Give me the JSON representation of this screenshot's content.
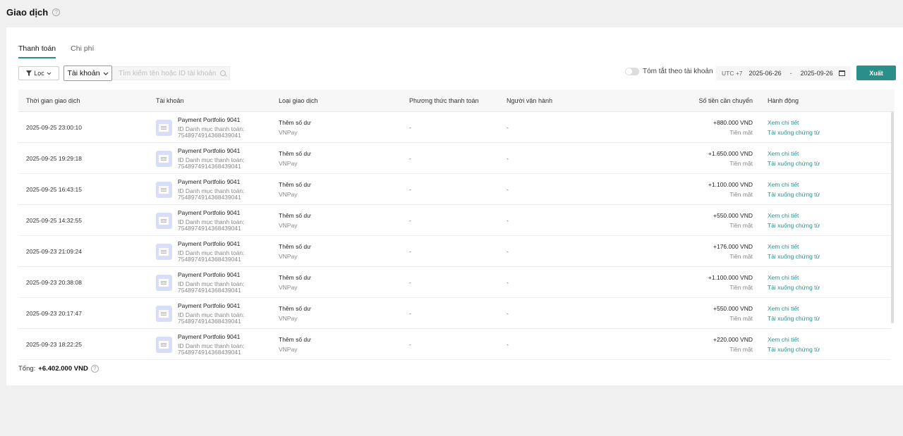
{
  "page": {
    "title": "Giao dịch"
  },
  "tabs": [
    {
      "label": "Thanh toán",
      "active": true
    },
    {
      "label": "Chi phí",
      "active": false
    }
  ],
  "toolbar": {
    "filter_label": "Lọc",
    "account_label": "Tài khoản",
    "search_placeholder": "Tìm kiếm tên hoặc ID tài khoản",
    "summary_toggle_label": "Tóm tắt theo tài khoản",
    "timezone": "UTC +7",
    "date_start": "2025-06-26",
    "date_separator": "-",
    "date_end": "2025-09-26",
    "export_label": "Xuất"
  },
  "table": {
    "headers": {
      "time": "Thời gian giao dịch",
      "account": "Tài khoản",
      "type": "Loại giao dịch",
      "payment_method": "Phương thức thanh toán",
      "operator": "Người vận hành",
      "amount": "Số tiền cần chuyển",
      "actions": "Hành động"
    },
    "rows": [
      {
        "time": "2025-09-25 23:00:10",
        "account_name": "Payment Portfolio 9041",
        "account_sub1": "ID Danh mục thanh toán:",
        "account_sub2": "7548974914368439041",
        "type": "Thêm số dư",
        "method": "VNPay",
        "payment": "-",
        "operator": "-",
        "amount": "+880.000 VND",
        "cash": "Tiền mặt",
        "action_view": "Xem chi tiết",
        "action_download": "Tải xuống chứng từ"
      },
      {
        "time": "2025-09-25 19:29:18",
        "account_name": "Payment Portfolio 9041",
        "account_sub1": "ID Danh mục thanh toán:",
        "account_sub2": "7548974914368439041",
        "type": "Thêm số dư",
        "method": "VNPay",
        "payment": "-",
        "operator": "-",
        "amount": "+1.650.000 VND",
        "cash": "Tiền mặt",
        "action_view": "Xem chi tiết",
        "action_download": "Tải xuống chứng từ"
      },
      {
        "time": "2025-09-25 16:43:15",
        "account_name": "Payment Portfolio 9041",
        "account_sub1": "ID Danh mục thanh toán:",
        "account_sub2": "7548974914368439041",
        "type": "Thêm số dư",
        "method": "VNPay",
        "payment": "-",
        "operator": "-",
        "amount": "+1.100.000 VND",
        "cash": "Tiền mặt",
        "action_view": "Xem chi tiết",
        "action_download": "Tải xuống chứng từ"
      },
      {
        "time": "2025-09-25 14:32:55",
        "account_name": "Payment Portfolio 9041",
        "account_sub1": "ID Danh mục thanh toán:",
        "account_sub2": "7548974914368439041",
        "type": "Thêm số dư",
        "method": "VNPay",
        "payment": "-",
        "operator": "-",
        "amount": "+550.000 VND",
        "cash": "Tiền mặt",
        "action_view": "Xem chi tiết",
        "action_download": "Tải xuống chứng từ"
      },
      {
        "time": "2025-09-23 21:09:24",
        "account_name": "Payment Portfolio 9041",
        "account_sub1": "ID Danh mục thanh toán:",
        "account_sub2": "7548974914368439041",
        "type": "Thêm số dư",
        "method": "VNPay",
        "payment": "-",
        "operator": "-",
        "amount": "+176.000 VND",
        "cash": "Tiền mặt",
        "action_view": "Xem chi tiết",
        "action_download": "Tải xuống chứng từ"
      },
      {
        "time": "2025-09-23 20:38:08",
        "account_name": "Payment Portfolio 9041",
        "account_sub1": "ID Danh mục thanh toán:",
        "account_sub2": "7548974914368439041",
        "type": "Thêm số dư",
        "method": "VNPay",
        "payment": "-",
        "operator": "-",
        "amount": "+1.100.000 VND",
        "cash": "Tiền mặt",
        "action_view": "Xem chi tiết",
        "action_download": "Tải xuống chứng từ"
      },
      {
        "time": "2025-09-23 20:17:47",
        "account_name": "Payment Portfolio 9041",
        "account_sub1": "ID Danh mục thanh toán:",
        "account_sub2": "7548974914368439041",
        "type": "Thêm số dư",
        "method": "VNPay",
        "payment": "-",
        "operator": "-",
        "amount": "+550.000 VND",
        "cash": "Tiền mặt",
        "action_view": "Xem chi tiết",
        "action_download": "Tải xuống chứng từ"
      },
      {
        "time": "2025-09-23 18:22:25",
        "account_name": "Payment Portfolio 9041",
        "account_sub1": "ID Danh mục thanh toán:",
        "account_sub2": "7548974914368439041",
        "type": "Thêm số dư",
        "method": "VNPay",
        "payment": "-",
        "operator": "-",
        "amount": "+220.000 VND",
        "cash": "Tiền mặt",
        "action_view": "Xem chi tiết",
        "action_download": "Tải xuống chứng từ"
      }
    ]
  },
  "total": {
    "label": "Tổng:",
    "value": "+6.402.000 VND"
  },
  "colors": {
    "accent": "#2a8f8a",
    "background": "#f0f0f0",
    "card": "#ffffff"
  },
  "icons": {
    "help": "question-circle-icon",
    "filter": "filter-icon",
    "chevron": "chevron-down-icon",
    "search": "search-icon",
    "calendar": "calendar-icon",
    "account": "account-card-icon"
  }
}
